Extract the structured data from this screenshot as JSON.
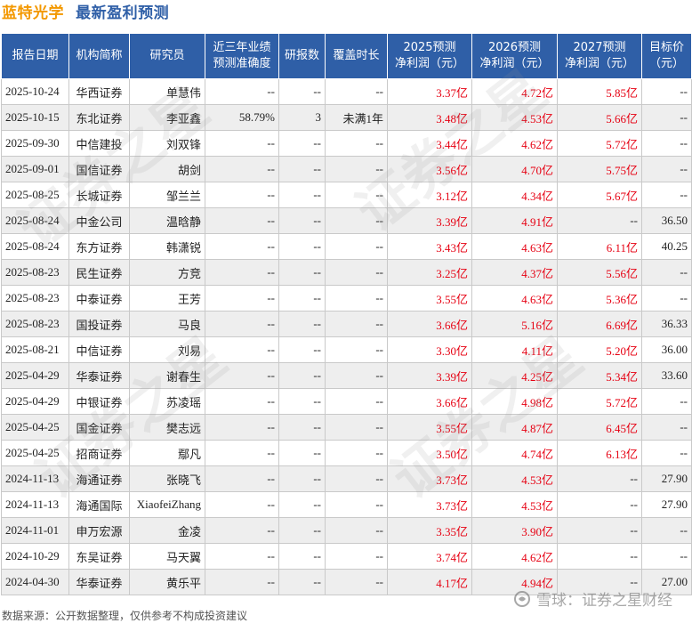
{
  "title": {
    "company": "蓝特光学",
    "section": "最新盈利预测"
  },
  "table": {
    "headers": [
      [
        "报告日期"
      ],
      [
        "机构简称"
      ],
      [
        "研究员"
      ],
      [
        "近三年业绩",
        "预测准确度"
      ],
      [
        "研报数"
      ],
      [
        "覆盖时长"
      ],
      [
        "2025预测",
        "净利润（元）"
      ],
      [
        "2026预测",
        "净利润（元）"
      ],
      [
        "2027预测",
        "净利润（元）"
      ],
      [
        "目标价",
        "（元）"
      ]
    ],
    "rows": [
      [
        "2025-10-24",
        "华西证券",
        "单慧伟",
        "--",
        "--",
        "--",
        "3.37亿",
        "4.72亿",
        "5.85亿",
        "--"
      ],
      [
        "2025-10-15",
        "东北证券",
        "李亚鑫",
        "58.79%",
        "3",
        "未满1年",
        "3.48亿",
        "4.53亿",
        "5.66亿",
        "--"
      ],
      [
        "2025-09-30",
        "中信建投",
        "刘双锋",
        "--",
        "--",
        "--",
        "3.44亿",
        "4.62亿",
        "5.72亿",
        "--"
      ],
      [
        "2025-09-01",
        "国信证券",
        "胡剑",
        "--",
        "--",
        "--",
        "3.56亿",
        "4.70亿",
        "5.75亿",
        "--"
      ],
      [
        "2025-08-25",
        "长城证券",
        "邹兰兰",
        "--",
        "--",
        "--",
        "3.12亿",
        "4.34亿",
        "5.67亿",
        "--"
      ],
      [
        "2025-08-24",
        "中金公司",
        "温晗静",
        "--",
        "--",
        "--",
        "3.39亿",
        "4.91亿",
        "--",
        "36.50"
      ],
      [
        "2025-08-24",
        "东方证券",
        "韩潇锐",
        "--",
        "--",
        "--",
        "3.43亿",
        "4.63亿",
        "6.11亿",
        "40.25"
      ],
      [
        "2025-08-23",
        "民生证券",
        "方竞",
        "--",
        "--",
        "--",
        "3.25亿",
        "4.37亿",
        "5.56亿",
        "--"
      ],
      [
        "2025-08-23",
        "中泰证券",
        "王芳",
        "--",
        "--",
        "--",
        "3.55亿",
        "4.63亿",
        "5.36亿",
        "--"
      ],
      [
        "2025-08-23",
        "国投证券",
        "马良",
        "--",
        "--",
        "--",
        "3.66亿",
        "5.16亿",
        "6.69亿",
        "36.33"
      ],
      [
        "2025-08-21",
        "中信证券",
        "刘易",
        "--",
        "--",
        "--",
        "3.30亿",
        "4.11亿",
        "5.20亿",
        "36.00"
      ],
      [
        "2025-04-29",
        "华泰证券",
        "谢春生",
        "--",
        "--",
        "--",
        "3.39亿",
        "4.25亿",
        "5.34亿",
        "33.60"
      ],
      [
        "2025-04-29",
        "中银证券",
        "苏凌瑶",
        "--",
        "--",
        "--",
        "3.66亿",
        "4.98亿",
        "5.72亿",
        "--"
      ],
      [
        "2025-04-25",
        "国金证券",
        "樊志远",
        "--",
        "--",
        "--",
        "3.55亿",
        "4.87亿",
        "6.45亿",
        "--"
      ],
      [
        "2025-04-25",
        "招商证券",
        "鄢凡",
        "--",
        "--",
        "--",
        "3.50亿",
        "4.74亿",
        "6.13亿",
        "--"
      ],
      [
        "2024-11-13",
        "海通证券",
        "张晓飞",
        "--",
        "--",
        "--",
        "3.73亿",
        "4.53亿",
        "--",
        "27.90"
      ],
      [
        "2024-11-13",
        "海通国际",
        "XiaofeiZhang",
        "--",
        "--",
        "--",
        "3.73亿",
        "4.53亿",
        "--",
        "27.90"
      ],
      [
        "2024-11-01",
        "申万宏源",
        "金凌",
        "--",
        "--",
        "--",
        "3.35亿",
        "3.90亿",
        "--",
        "--"
      ],
      [
        "2024-10-29",
        "东吴证券",
        "马天翼",
        "--",
        "--",
        "--",
        "3.74亿",
        "4.62亿",
        "--",
        "--"
      ],
      [
        "2024-04-30",
        "华泰证券",
        "黄乐平",
        "--",
        "--",
        "--",
        "4.17亿",
        "4.94亿",
        "--",
        "27.00"
      ]
    ]
  },
  "footer": {
    "source": "数据来源：公开数据整理，仅供参考不构成投资建议"
  },
  "watermark": {
    "text": "证券之星",
    "brand": "雪球：证券之星财经"
  },
  "colors": {
    "header_bg": "#2f5fa7",
    "title_company": "#f39800",
    "title_section": "#2f5fa7",
    "forecast_text": "#e60012",
    "stripe": "#eeeeee"
  }
}
